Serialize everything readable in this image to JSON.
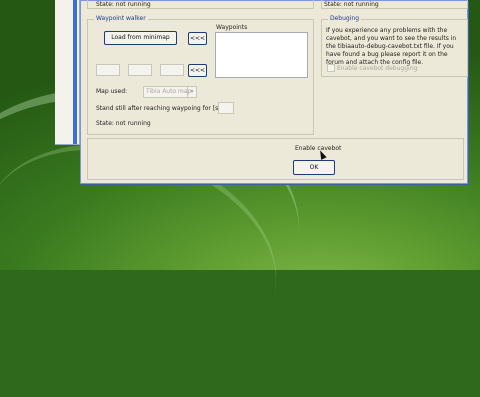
{
  "top_states": {
    "left": "State: not running",
    "right": "State: not running"
  },
  "waypoint_walker": {
    "title": "Waypoint walker",
    "load_button": "Load from minimap",
    "ellipsis_button_1": "<<<",
    "ellipsis_button_2": "<<<",
    "coord_fields": [
      "",
      "",
      ""
    ],
    "waypoints_label": "Waypoints",
    "map_used_label": "Map used:",
    "map_used_value": "Tibia Auto map",
    "stand_still_label": "Stand still after reaching waypoing for [s]",
    "state": "State: not running"
  },
  "debugging": {
    "title": "Debuging",
    "info": "If you experience any problems with the cavebot, and you want to see the results in the tibiaauto-debug-cavebot.txt file. If you have found a bug please report it on the forum and attach the config file.",
    "checkbox_label": "Enable cavebot debugging"
  },
  "footer": {
    "enable_label": "Enable cavebot",
    "ok_label": "OK"
  }
}
